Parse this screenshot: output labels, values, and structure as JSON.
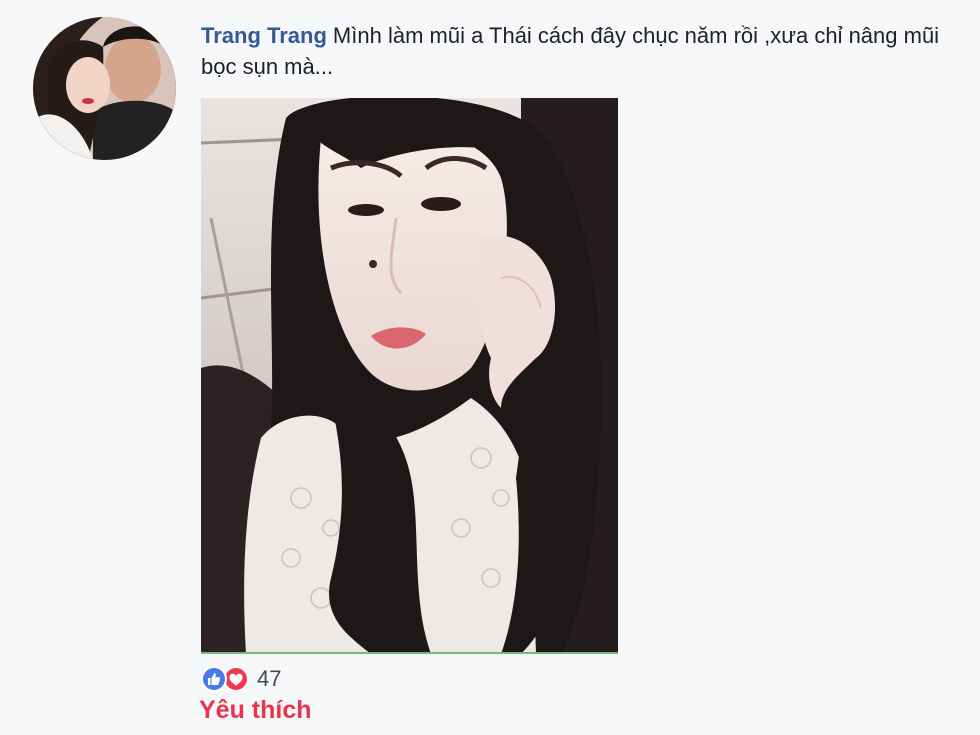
{
  "comment": {
    "author": "Trang Trang",
    "text": "Mình làm mũi a Thái cách đây chục năm rồi ,xưa chỉ nâng mũi bọc sụn mà..."
  },
  "reactions": {
    "icons": [
      "thumbs-up-icon",
      "heart-icon"
    ],
    "count": "47",
    "colors": {
      "like": "#4a79e8",
      "love": "#f0384f"
    }
  },
  "actions": {
    "like_label": "Yêu thích"
  },
  "colors": {
    "author_name": "#365899",
    "action_active": "#e8354c",
    "background": "#f6f7f9"
  }
}
